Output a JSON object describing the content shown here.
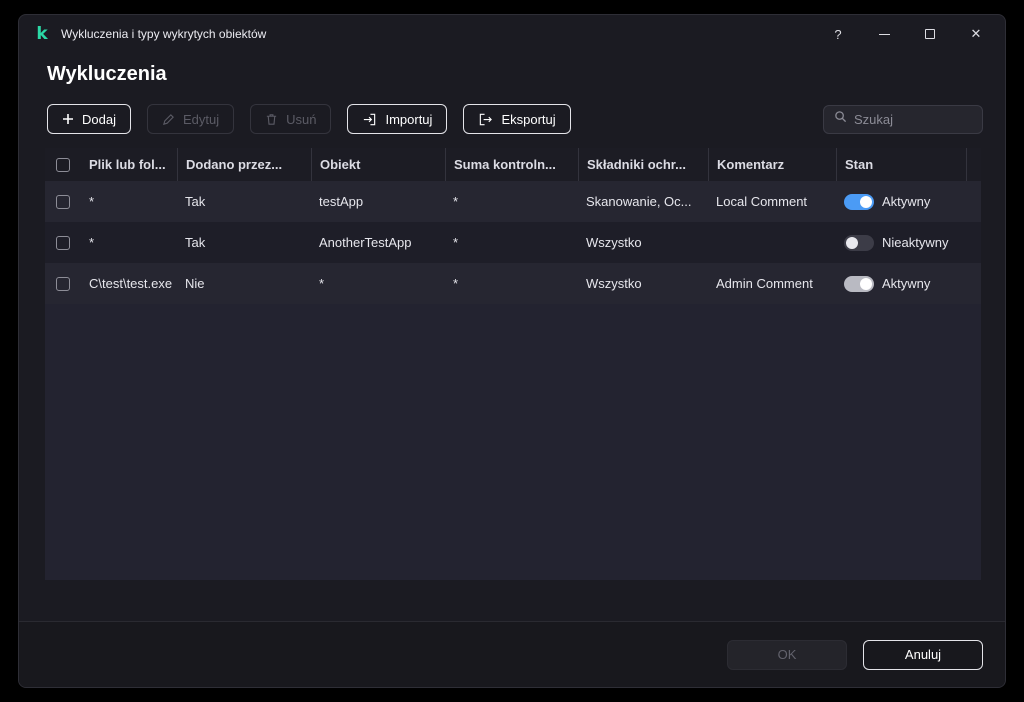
{
  "window": {
    "title": "Wykluczenia i typy wykrytych obiektów",
    "controls": {
      "help": "?",
      "close": "✕"
    }
  },
  "page": {
    "title": "Wykluczenia"
  },
  "toolbar": {
    "add": "Dodaj",
    "edit": "Edytuj",
    "delete": "Usuń",
    "import": "Importuj",
    "export": "Eksportuj",
    "search_placeholder": "Szukaj"
  },
  "colors": {
    "brand_green": "#2bd9a6",
    "toggle_active_blue": "#4b9bf5",
    "toggle_admin_gray": "#b9bac2"
  },
  "table": {
    "columns": [
      "Plik lub fol...",
      "Dodano przez...",
      "Obiekt",
      "Suma kontroln...",
      "Składniki ochr...",
      "Komentarz",
      "Stan"
    ],
    "rows": [
      {
        "path": "*",
        "added_by": "Tak",
        "object": "testApp",
        "checksum": "*",
        "components": "Skanowanie, Oc...",
        "comment": "Local Comment",
        "state": "Aktywny",
        "toggle_on": true,
        "toggle_color": "blue"
      },
      {
        "path": "*",
        "added_by": "Tak",
        "object": "AnotherTestApp",
        "checksum": "*",
        "components": "Wszystko",
        "comment": "",
        "state": "Nieaktywny",
        "toggle_on": false,
        "toggle_color": "dark"
      },
      {
        "path": "C\\test\\test.exe",
        "added_by": "Nie",
        "object": "*",
        "checksum": "*",
        "components": "Wszystko",
        "comment": "Admin Comment",
        "state": "Aktywny",
        "toggle_on": true,
        "toggle_color": "gray"
      }
    ]
  },
  "footer": {
    "ok": "OK",
    "cancel": "Anuluj"
  }
}
